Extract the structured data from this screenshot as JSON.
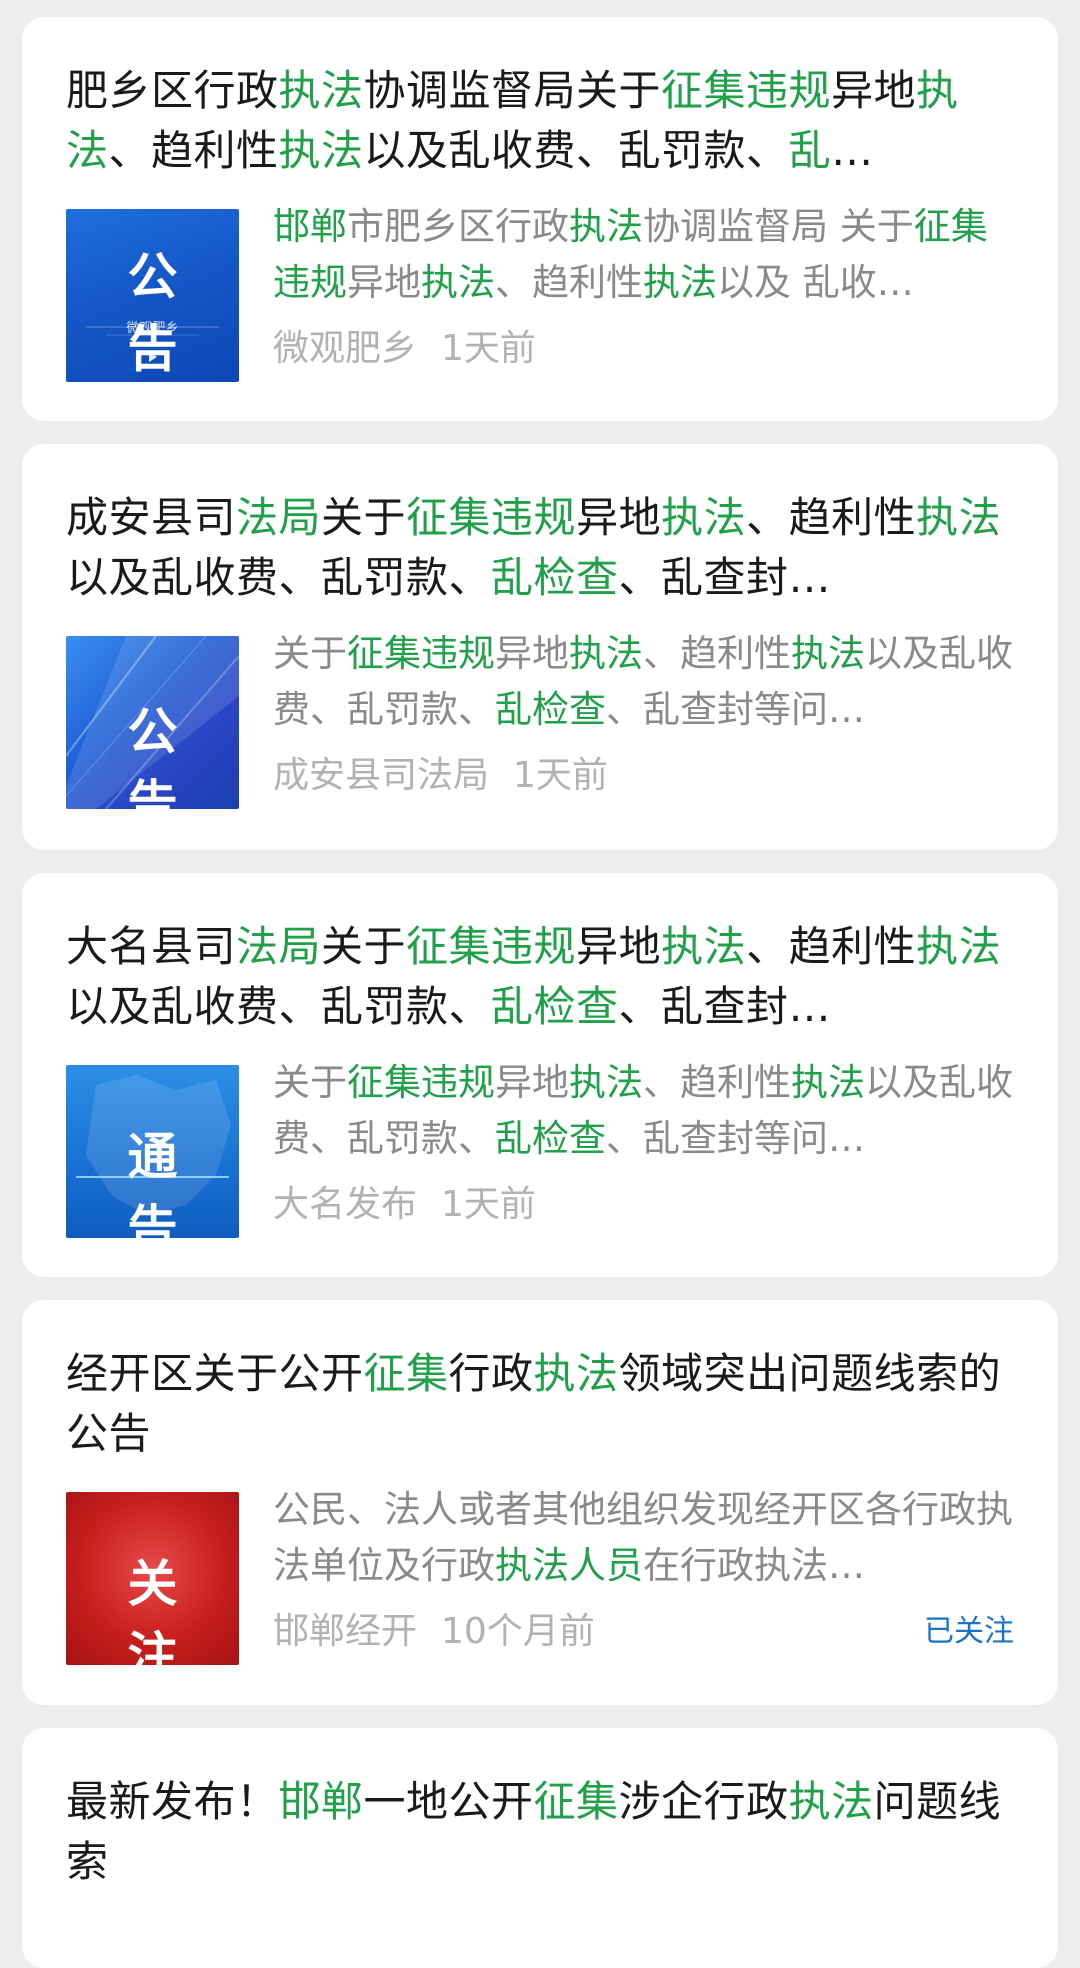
{
  "colors": {
    "highlight": "#21a04a",
    "title": "#1a1a1a",
    "summary": "#8a8a8a",
    "meta": "#b2b2b2",
    "follow": "#1a73c8",
    "background": "#ededed"
  },
  "cards": [
    {
      "title": [
        {
          "t": "肥乡区行政",
          "hl": false
        },
        {
          "t": "执法",
          "hl": true
        },
        {
          "t": "协调监督局关于",
          "hl": false
        },
        {
          "t": "征集违规",
          "hl": true
        },
        {
          "t": "异地",
          "hl": false
        },
        {
          "t": "执法",
          "hl": true
        },
        {
          "t": "、趋利性",
          "hl": false
        },
        {
          "t": "执法",
          "hl": true
        },
        {
          "t": "以及乱收费、乱罚款、",
          "hl": false
        },
        {
          "t": "乱",
          "hl": true
        },
        {
          "t": "…",
          "hl": false
        }
      ],
      "thumb": {
        "label": "公 告",
        "sub": "微观肥乡",
        "style": "blue-announce",
        "play_icon": true
      },
      "summary": [
        {
          "t": "邯郸",
          "hl": true
        },
        {
          "t": "市肥乡区行政",
          "hl": false
        },
        {
          "t": "执法",
          "hl": true
        },
        {
          "t": "协调监督局 关于",
          "hl": false
        },
        {
          "t": "征集违规",
          "hl": true
        },
        {
          "t": "异地",
          "hl": false
        },
        {
          "t": "执法",
          "hl": true
        },
        {
          "t": "、趋利性",
          "hl": false
        },
        {
          "t": "执法",
          "hl": true
        },
        {
          "t": "以及 乱收…",
          "hl": false
        }
      ],
      "source": "微观肥乡",
      "time": "1天前",
      "follow": ""
    },
    {
      "title": [
        {
          "t": "成安县司",
          "hl": false
        },
        {
          "t": "法局",
          "hl": true
        },
        {
          "t": "关于",
          "hl": false
        },
        {
          "t": "征集违规",
          "hl": true
        },
        {
          "t": "异地",
          "hl": false
        },
        {
          "t": "执法",
          "hl": true
        },
        {
          "t": "、趋利性",
          "hl": false
        },
        {
          "t": "执法",
          "hl": true
        },
        {
          "t": "以及乱收费、乱罚款、",
          "hl": false
        },
        {
          "t": "乱检查",
          "hl": true
        },
        {
          "t": "、乱查封…",
          "hl": false
        }
      ],
      "thumb": {
        "label": "公 告",
        "sub": "",
        "style": "blue-streak",
        "play_icon": false
      },
      "summary": [
        {
          "t": "关于",
          "hl": false
        },
        {
          "t": "征集违规",
          "hl": true
        },
        {
          "t": "异地",
          "hl": false
        },
        {
          "t": "执法",
          "hl": true
        },
        {
          "t": "、趋利性",
          "hl": false
        },
        {
          "t": "执法",
          "hl": true
        },
        {
          "t": "以及乱收费、乱罚款、",
          "hl": false
        },
        {
          "t": "乱检查",
          "hl": true
        },
        {
          "t": "、乱查封等问…",
          "hl": false
        }
      ],
      "source": "成安县司法局",
      "time": "1天前",
      "follow": ""
    },
    {
      "title": [
        {
          "t": "大名县司",
          "hl": false
        },
        {
          "t": "法局",
          "hl": true
        },
        {
          "t": "关于",
          "hl": false
        },
        {
          "t": "征集违规",
          "hl": true
        },
        {
          "t": "异地",
          "hl": false
        },
        {
          "t": "执法",
          "hl": true
        },
        {
          "t": "、趋利性",
          "hl": false
        },
        {
          "t": "执法",
          "hl": true
        },
        {
          "t": "以及乱收费、乱罚款、",
          "hl": false
        },
        {
          "t": "乱检查",
          "hl": true
        },
        {
          "t": "、乱查封…",
          "hl": false
        }
      ],
      "thumb": {
        "label": "通 告",
        "sub": "",
        "style": "blue-map",
        "play_icon": false
      },
      "summary": [
        {
          "t": "关于",
          "hl": false
        },
        {
          "t": "征集违规",
          "hl": true
        },
        {
          "t": "异地",
          "hl": false
        },
        {
          "t": "执法",
          "hl": true
        },
        {
          "t": "、趋利性",
          "hl": false
        },
        {
          "t": "执法",
          "hl": true
        },
        {
          "t": "以及乱收费、乱罚款、",
          "hl": false
        },
        {
          "t": "乱检查",
          "hl": true
        },
        {
          "t": "、乱查封等问…",
          "hl": false
        }
      ],
      "source": "大名发布",
      "time": "1天前",
      "follow": ""
    },
    {
      "title": [
        {
          "t": "经开区关于公开",
          "hl": false
        },
        {
          "t": "征集",
          "hl": true
        },
        {
          "t": "行政",
          "hl": false
        },
        {
          "t": "执法",
          "hl": true
        },
        {
          "t": "领域突出问题线索的公告",
          "hl": false
        }
      ],
      "thumb": {
        "label": "关 注",
        "sub": "",
        "style": "red-focus",
        "play_icon": false
      },
      "summary": [
        {
          "t": "公民、法人或者其他组织发现经开区各行政执法单位及行政",
          "hl": false
        },
        {
          "t": "执法人员",
          "hl": true
        },
        {
          "t": "在行政执法…",
          "hl": false
        }
      ],
      "source": "邯郸经开",
      "time": "10个月前",
      "follow": "已关注"
    },
    {
      "title": [
        {
          "t": "最新发布！",
          "hl": false
        },
        {
          "t": "邯郸",
          "hl": true
        },
        {
          "t": "一地公开",
          "hl": false
        },
        {
          "t": "征集",
          "hl": true
        },
        {
          "t": "涉企行政",
          "hl": false
        },
        {
          "t": "执法",
          "hl": true
        },
        {
          "t": "问题线索",
          "hl": false
        }
      ],
      "thumb": null,
      "summary": [],
      "source": "",
      "time": "",
      "follow": ""
    }
  ]
}
